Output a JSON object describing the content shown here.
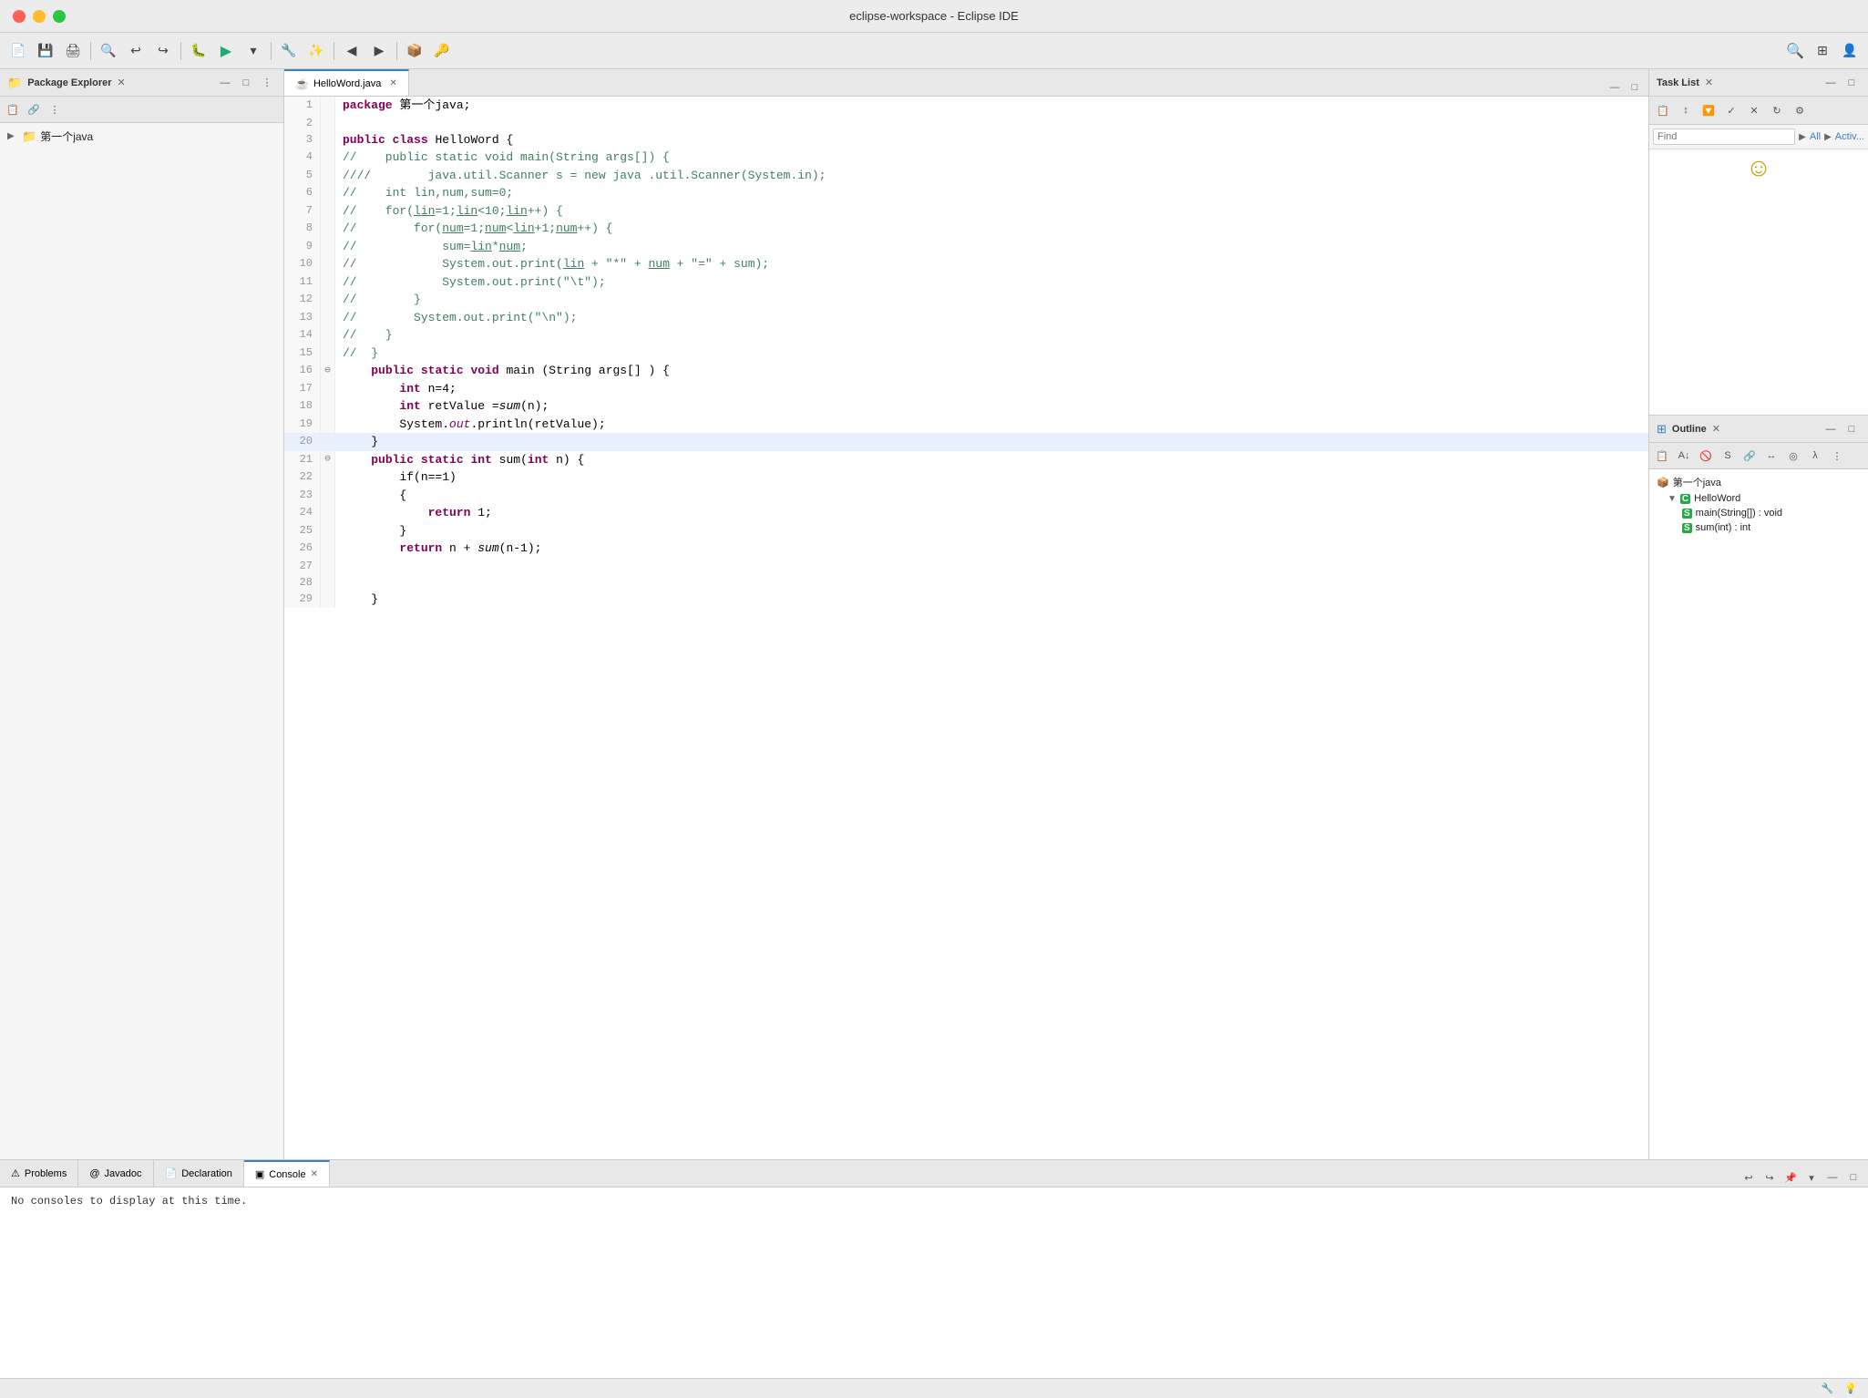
{
  "window": {
    "title": "eclipse-workspace - Eclipse IDE"
  },
  "toolbar": {
    "run_label": "▶",
    "search_placeholder": ""
  },
  "package_explorer": {
    "title": "Package Explorer",
    "close_label": "✕",
    "project": "第一个java"
  },
  "editor": {
    "tab_title": "HelloWord.java",
    "tab_close": "✕",
    "code_lines": [
      {
        "num": 1,
        "text": "package 第一个java;"
      },
      {
        "num": 2,
        "text": ""
      },
      {
        "num": 3,
        "text": "public class HelloWord {"
      },
      {
        "num": 4,
        "text": "//    public static void main(String args[]) {"
      },
      {
        "num": 5,
        "text": "////        java.util.Scanner s = new java .util.Scanner(System.in);"
      },
      {
        "num": 6,
        "text": "//    int lin,num,sum=0;"
      },
      {
        "num": 7,
        "text": "//    for(lin=1;lin<10;lin++) {"
      },
      {
        "num": 8,
        "text": "//        for(num=1;num<lin+1;num++) {"
      },
      {
        "num": 9,
        "text": "//            sum=lin*num;"
      },
      {
        "num": 10,
        "text": "//            System.out.print(lin + \"*\" + num + \"=\" + sum);"
      },
      {
        "num": 11,
        "text": "//            System.out.print(\"\\t\");"
      },
      {
        "num": 12,
        "text": "//        }"
      },
      {
        "num": 13,
        "text": "//        System.out.print(\"\\n\");"
      },
      {
        "num": 14,
        "text": "//    }"
      },
      {
        "num": 15,
        "text": "//  }"
      },
      {
        "num": 16,
        "text": "    public static void main (String args[] ) {",
        "gutter": "⊖"
      },
      {
        "num": 17,
        "text": "        int n=4;"
      },
      {
        "num": 18,
        "text": "        int retValue =sum(n);"
      },
      {
        "num": 19,
        "text": "        System.out.println(retValue);"
      },
      {
        "num": 20,
        "text": "    }",
        "highlighted": true
      },
      {
        "num": 21,
        "text": "    public static int sum(int n) {",
        "gutter": "⊖"
      },
      {
        "num": 22,
        "text": "        if(n==1)"
      },
      {
        "num": 23,
        "text": "        {"
      },
      {
        "num": 24,
        "text": "            return 1;"
      },
      {
        "num": 25,
        "text": "        }"
      },
      {
        "num": 26,
        "text": "        return n + sum(n-1);"
      },
      {
        "num": 27,
        "text": ""
      },
      {
        "num": 28,
        "text": ""
      },
      {
        "num": 29,
        "text": "    }"
      }
    ]
  },
  "task_list": {
    "title": "Task List",
    "close_label": "✕",
    "find_placeholder": "Find",
    "all_label": "All",
    "activ_label": "Activ..."
  },
  "outline": {
    "title": "Outline",
    "close_label": "✕",
    "items": [
      {
        "label": "第一个java",
        "level": 0,
        "icon": "pkg",
        "arrow": "▼"
      },
      {
        "label": "HelloWord",
        "level": 1,
        "icon": "class",
        "arrow": "▼"
      },
      {
        "label": "main(String[]) : void",
        "level": 2,
        "icon": "method-green"
      },
      {
        "label": "sum(int) : int",
        "level": 2,
        "icon": "method-green"
      }
    ]
  },
  "bottom_tabs": [
    {
      "label": "Problems",
      "icon": "⚠",
      "active": false
    },
    {
      "label": "Javadoc",
      "icon": "@",
      "active": false
    },
    {
      "label": "Declaration",
      "icon": "📄",
      "active": false
    },
    {
      "label": "Console",
      "icon": "▣",
      "active": true,
      "close": "✕"
    }
  ],
  "console": {
    "empty_message": "No consoles to display at this time."
  },
  "status_bar": {
    "items": []
  }
}
